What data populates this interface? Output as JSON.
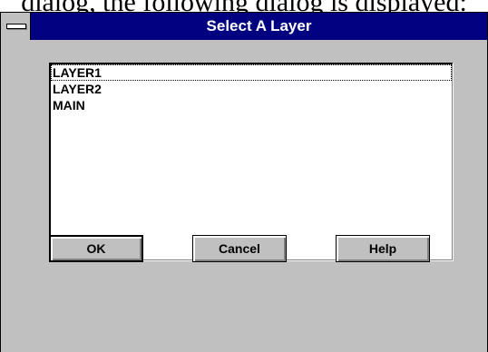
{
  "context": {
    "caption": "dialog, the following dialog is displayed:"
  },
  "dialog": {
    "title": "Select A Layer",
    "sysmenu_icon": "system-menu-icon",
    "layers": [
      {
        "label": "LAYER1",
        "focused": true
      },
      {
        "label": "LAYER2",
        "focused": false
      },
      {
        "label": "MAIN",
        "focused": false
      }
    ],
    "buttons": {
      "ok": "OK",
      "cancel": "Cancel",
      "help": "Help"
    }
  },
  "colors": {
    "titlebar": "#000080",
    "face": "#c0c0c0"
  }
}
